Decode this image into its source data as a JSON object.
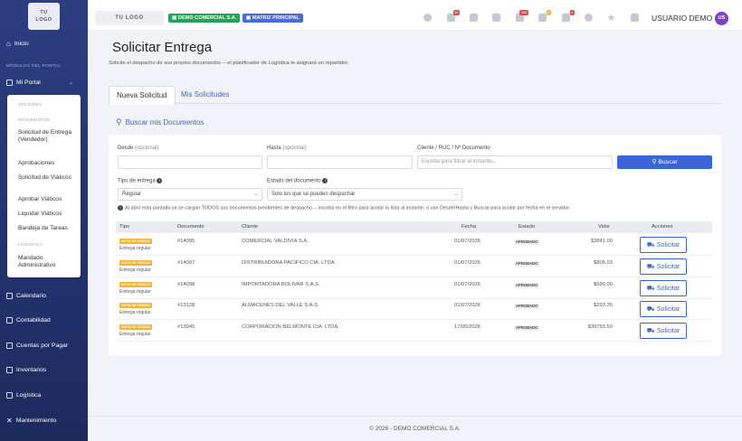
{
  "sidebar": {
    "logo": [
      "TU",
      "LOGO"
    ],
    "inicio": "Inicio",
    "section_modulos": "MÓDULOS DEL PORTAL",
    "mi_portal": "Mi Portal",
    "submenu": {
      "section_opciones": "OPCIONES",
      "section_movimientos": "MOVIMIENTOS",
      "items_mov": [
        "Solicitud de Entrega (Vendedor)",
        "Aprobaciones",
        "Solicitud de Viáticos",
        "Aprobar Viáticos",
        "Liquidar Viáticos",
        "Bandeja de Tareas"
      ],
      "section_logistica": "LOGÍSTICA",
      "items_log": [
        "Mandado Administrativo"
      ]
    },
    "items": [
      "Calendario",
      "Contabilidad",
      "Cuentas por Pagar",
      "Inventarios",
      "Logística",
      "Mantenimiento"
    ]
  },
  "topbar": {
    "logo": "TU LOGO",
    "company_badge": "DEMO COMERCIAL S.A.",
    "branch_badge": "MATRIZ PRINCIPAL",
    "counts": [
      "39",
      "160",
      "8",
      "4"
    ],
    "user_name": "USUARIO DEMO",
    "avatar": "US"
  },
  "page": {
    "title": "Solicitar Entrega",
    "subtitle": "Solicite el despacho de sus propios documentos -- el planificador de Logística le asignará un repartidor.",
    "tabs": [
      "Nueva Solicitud",
      "Mis Solicitudes"
    ],
    "search_heading": "Buscar mis Documentos"
  },
  "filters": {
    "desde_label": "Desde",
    "hasta_label": "Hasta",
    "optional": "(opcional)",
    "cliente_label": "Cliente / RUC / Nº Documento",
    "cliente_placeholder": "Escriba para filtrar al instante...",
    "buscar_button": "Buscar",
    "tipo_label": "Tipo de entrega",
    "tipo_value": "Regular",
    "estado_label": "Estado del documento",
    "estado_value": "Solo los que se pueden despachar",
    "info": "Al abrir esta pantalla ya se cargan TODOS sus documentos pendientes de despacho -- escriba en el filtro para acotar la lista al instante, o use Desde/Hasta y Buscar para acotar por fecha en el servidor."
  },
  "table": {
    "headers": [
      "Tipo",
      "Documento",
      "Cliente",
      "Fecha",
      "Estado",
      "Valor",
      "Acciones"
    ],
    "rows": [
      {
        "tipo": "NOTA DE PEDIDO",
        "entrega": "Entrega regular",
        "documento": "#14095",
        "cliente": "COMERCIAL VALDIVIA S.A.",
        "fecha": "01/07/2026",
        "estado": "APROBADO",
        "valor": "$3841.00",
        "accion": "Solicitar"
      },
      {
        "tipo": "NOTA DE PEDIDO",
        "entrega": "Entrega regular",
        "documento": "#14097",
        "cliente": "DISTRIBUIDORA PACIFICO CIA. LTDA.",
        "fecha": "01/07/2026",
        "estado": "APROBADO",
        "valor": "$805.03",
        "accion": "Solicitar"
      },
      {
        "tipo": "NOTA DE PEDIDO",
        "entrega": "Entrega regular",
        "documento": "#14098",
        "cliente": "IMPORTADORA BOLIVAR S.A.S.",
        "fecha": "01/07/2026",
        "estado": "APROBADO",
        "valor": "$690.00",
        "accion": "Solicitar"
      },
      {
        "tipo": "NOTA DE PEDIDO",
        "entrega": "Entrega regular",
        "documento": "#13128",
        "cliente": "ALMACENES DEL VALLE S.A.S.",
        "fecha": "01/07/2026",
        "estado": "APROBADO",
        "valor": "$293.25",
        "accion": "Solicitar"
      },
      {
        "tipo": "NOTA DE PEDIDO",
        "entrega": "Entrega regular",
        "documento": "#13045",
        "cliente": "CORPORACION BELMONTE CIA. LTDA.",
        "fecha": "17/06/2026",
        "estado": "APROBADO",
        "valor": "$39755.50",
        "accion": "Solicitar"
      }
    ]
  },
  "footer": "© 2026 - DEMO COMERCIAL S.A.",
  "colors": {
    "sidebar": "#2c3e80",
    "accent": "#3d63d9",
    "badge_green": "#23a455",
    "badge_yellow": "#f5b335",
    "avatar": "#7b45c9"
  }
}
